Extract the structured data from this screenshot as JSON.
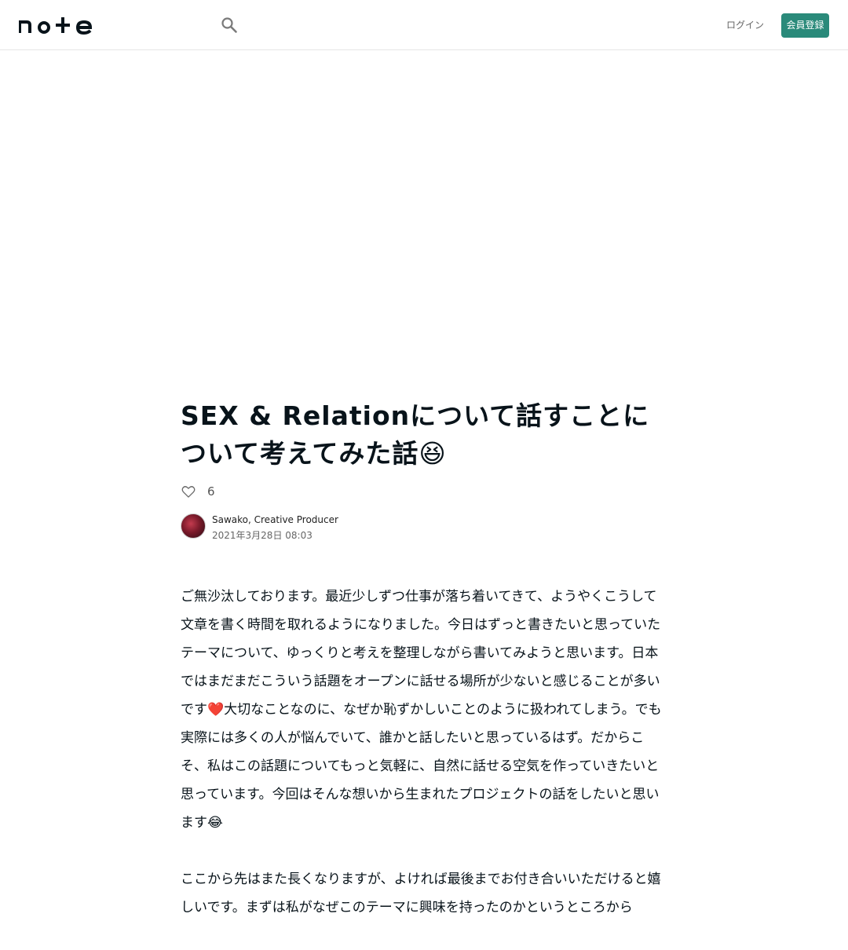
{
  "header": {
    "logo_alt": "note",
    "search_icon": "search-icon",
    "login_label": "ログイン",
    "signup_label": "会員登録",
    "accent_color": "#2a8a7a"
  },
  "article": {
    "title": "SEX & Relationについて話すことについて考えてみた話😆",
    "like_icon": "heart-outline-icon",
    "like_count": "6",
    "author_name": "Sawako, Creative Producer",
    "post_date": "2021年3月28日 08:03",
    "paragraphs": [
      "ご無沙汰しております。最近少しずつ仕事が落ち着いてきて、ようやくこうして文章を書く時間を取れるようになりました。今日はずっと書きたいと思っていたテーマについて、ゆっくりと考えを整理しながら書いてみようと思います。日本ではまだまだこういう話題をオープンに話せる場所が少ないと感じることが多いです❤️大切なことなのに、なぜか恥ずかしいことのように扱われてしまう。でも実際には多くの人が悩んでいて、誰かと話したいと思っているはず。だからこそ、私はこの話題についてもっと気軽に、自然に話せる空気を作っていきたいと思っています。今回はそんな想いから生まれたプロジェクトの話をしたいと思います😂",
      "ここから先はまた長くなりますが、よければ最後までお付き合いいただけると嬉しいです。まずは私がなぜこのテーマに興味を持ったのかというところから"
    ]
  }
}
